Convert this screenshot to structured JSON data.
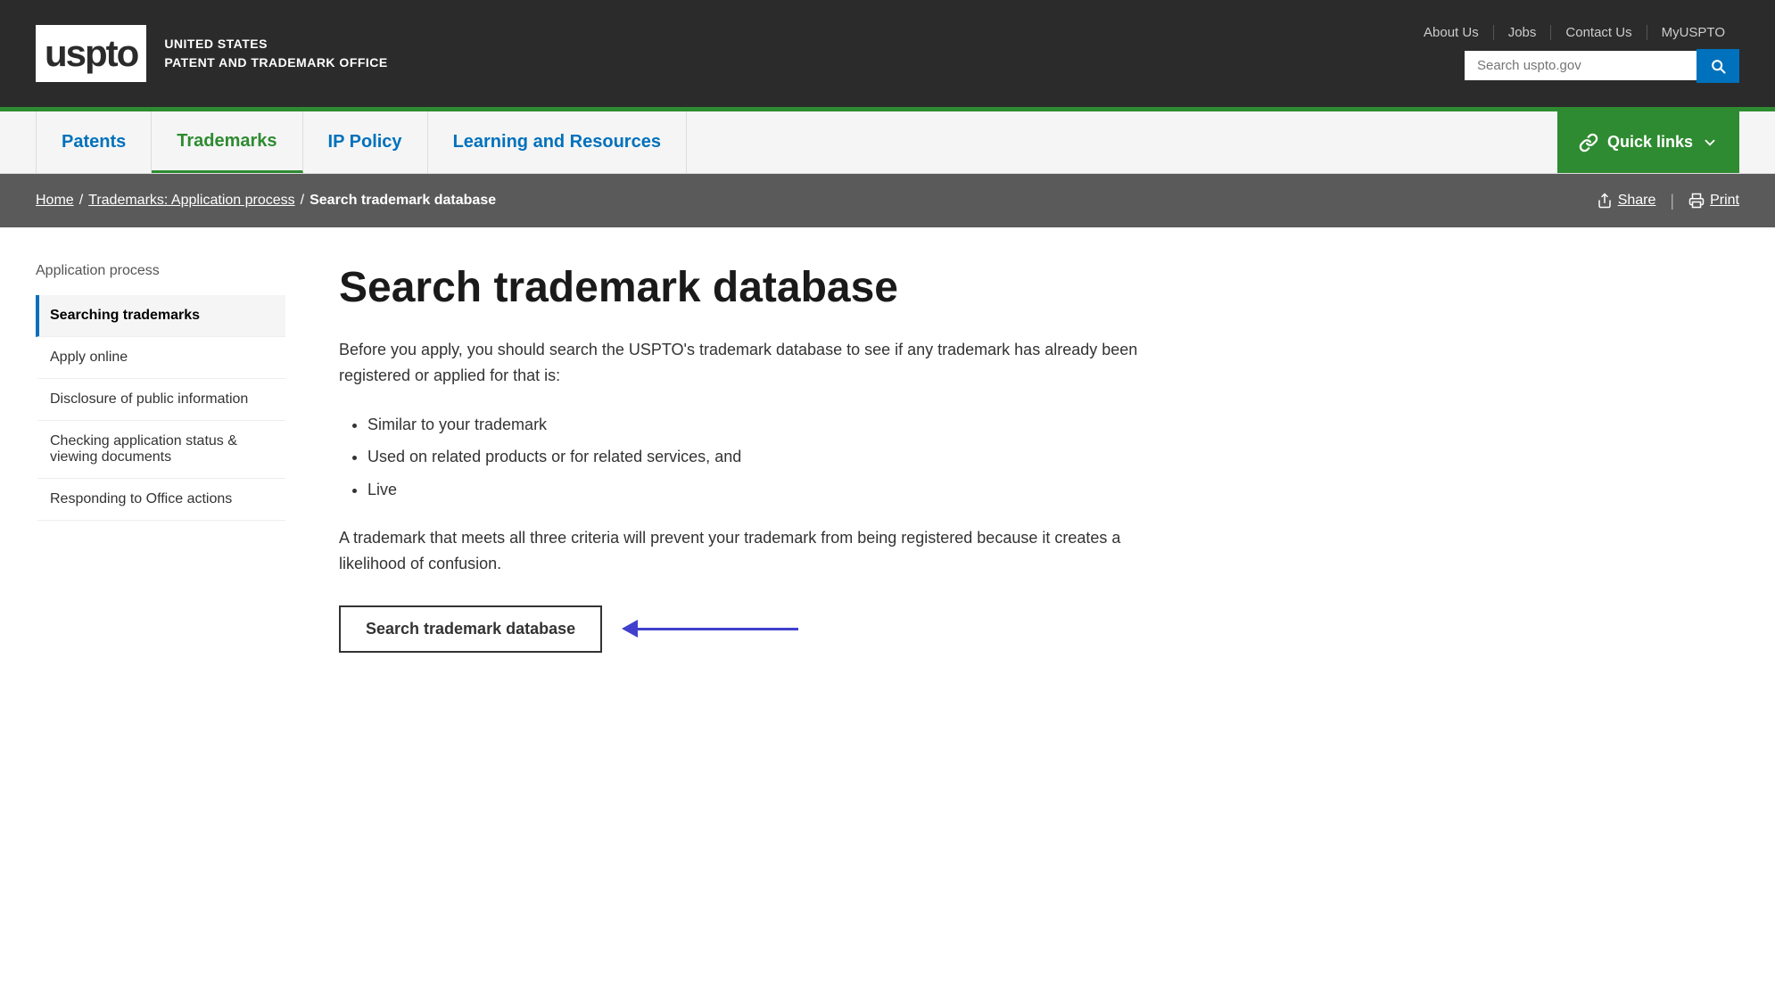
{
  "topbar": {
    "logo_text": "uspto",
    "agency_line1": "UNITED STATES",
    "agency_line2": "PATENT AND TRADEMARK OFFICE",
    "links": [
      {
        "label": "About Us",
        "href": "#"
      },
      {
        "label": "Jobs",
        "href": "#"
      },
      {
        "label": "Contact Us",
        "href": "#"
      },
      {
        "label": "MyUSPTO",
        "href": "#"
      }
    ],
    "search_placeholder": "Search uspto.gov"
  },
  "nav": {
    "items": [
      {
        "label": "Patents",
        "active": false
      },
      {
        "label": "Trademarks",
        "active": true
      },
      {
        "label": "IP Policy",
        "active": false
      },
      {
        "label": "Learning and Resources",
        "active": false
      }
    ],
    "quick_links_label": "Quick links"
  },
  "breadcrumb": {
    "home": "Home",
    "section": "Trademarks: Application process",
    "current": "Search trademark database",
    "share": "Share",
    "print": "Print"
  },
  "sidebar": {
    "title": "Application process",
    "items": [
      {
        "label": "Searching trademarks",
        "active": true
      },
      {
        "label": "Apply online",
        "active": false
      },
      {
        "label": "Disclosure of public information",
        "active": false
      },
      {
        "label": "Checking application status & viewing documents",
        "active": false
      },
      {
        "label": "Responding to Office actions",
        "active": false
      }
    ]
  },
  "main": {
    "title": "Search trademark database",
    "intro": "Before you apply, you should search the USPTO's trademark database to see if any trademark has already been registered or applied for that is:",
    "bullets": [
      "Similar to your trademark",
      "Used on related products or for related services, and",
      "Live"
    ],
    "para": "A trademark that meets all three criteria will prevent your trademark from being registered because it creates a likelihood of confusion.",
    "cta_button": "Search trademark database"
  }
}
